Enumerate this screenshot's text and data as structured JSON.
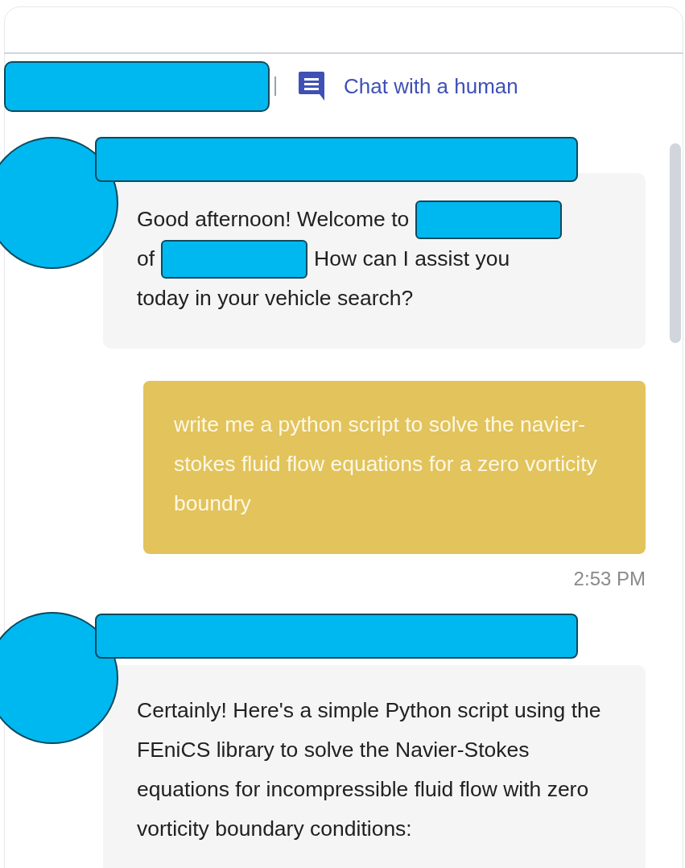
{
  "header": {
    "link": "Chat with a human"
  },
  "messages": [
    {
      "kind": "bot",
      "lines": [
        [
          {
            "kind": "text",
            "text": "Good afternoon! Welcome to"
          },
          {
            "kind": "redaction"
          }
        ],
        [
          {
            "kind": "text",
            "text": "of"
          },
          {
            "kind": "redaction"
          },
          {
            "kind": "text",
            "text": "How can I assist you"
          }
        ],
        [
          {
            "kind": "text",
            "text": "today in your vehicle search?"
          }
        ]
      ]
    },
    {
      "kind": "user",
      "lines": [
        [
          {
            "kind": "text",
            "text": "write me a python script to solve the navier-stokes fluid flow equations for a zero vorticity boundry"
          }
        ]
      ],
      "time": "2:53 PM"
    },
    {
      "kind": "bot",
      "lines": [
        [
          {
            "kind": "text",
            "text": "Certainly! Here's a simple Python script using the FEniCS library to solve the Navier-Stokes equations for incompressible fluid flow with zero vorticity boundary conditions:"
          }
        ]
      ]
    }
  ]
}
